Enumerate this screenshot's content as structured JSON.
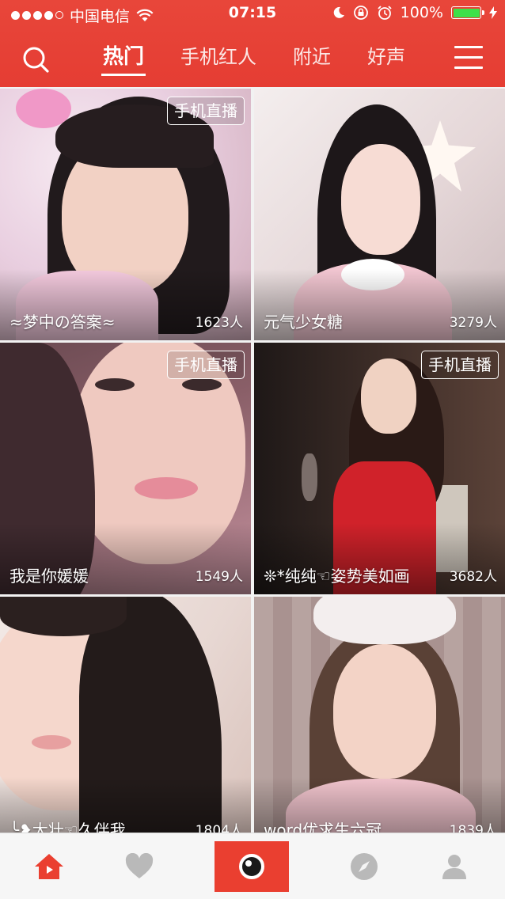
{
  "status_bar": {
    "carrier": "中国电信",
    "time": "07:15",
    "battery": "100%"
  },
  "nav": {
    "tabs": [
      {
        "label": "热门"
      },
      {
        "label": "手机红人"
      },
      {
        "label": "附近"
      },
      {
        "label": "好声"
      }
    ]
  },
  "cards": [
    {
      "name": "≈梦中の答案≈",
      "count": "1623人",
      "badge": "手机直播"
    },
    {
      "name": "元气少女糖",
      "count": "3279人",
      "badge": ""
    },
    {
      "name": "我是你媛媛",
      "count": "1549人",
      "badge": "手机直播"
    },
    {
      "name": "❊*纯纯☜姿势美如画",
      "count": "3682人",
      "badge": "手机直播"
    },
    {
      "name": "╰❥大壮☜久伴我",
      "count": "1804人",
      "badge": ""
    },
    {
      "name": "word优求生六冠",
      "count": "1839人",
      "badge": ""
    }
  ],
  "tabbar": {
    "items": [
      {
        "icon": "home-icon",
        "active": true
      },
      {
        "icon": "heart-icon",
        "active": false
      },
      {
        "icon": "eye-icon",
        "active": false
      },
      {
        "icon": "compass-icon",
        "active": false
      },
      {
        "icon": "profile-icon",
        "active": false
      }
    ]
  },
  "colors": {
    "accent": "#e53d33",
    "battery": "#3ee04a"
  }
}
